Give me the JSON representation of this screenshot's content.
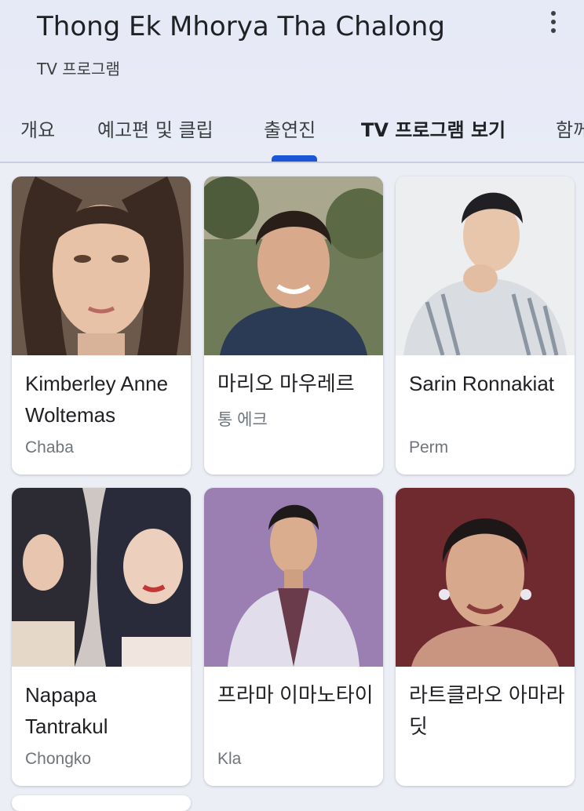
{
  "header": {
    "title": "Thong Ek Mhorya Tha Chalong",
    "subtitle": "TV 프로그램",
    "menu_icon": "more-vert-icon"
  },
  "tabs": [
    {
      "label": "개요",
      "selected": false
    },
    {
      "label": "예고편 및 클립",
      "selected": false
    },
    {
      "label": "출연진",
      "selected": true
    },
    {
      "label": "TV 프로그램 보기",
      "selected": false
    },
    {
      "label": "함께",
      "selected": false
    }
  ],
  "colors": {
    "header_bg": "#e6e9f6",
    "page_bg": "#eceef6",
    "tab_indicator": "#1a56d6",
    "secondary_text": "#70757a"
  },
  "cast": [
    {
      "name": "Kimberley Anne Woltemas",
      "role": "Chaba"
    },
    {
      "name": "마리오 마우레르",
      "role": "통 에크"
    },
    {
      "name": "Sarin Ronnakiat",
      "role": "Perm"
    },
    {
      "name": "Napapa Tantrakul",
      "role": "Chongko"
    },
    {
      "name": "프라마 이마노타이",
      "role": "Kla"
    },
    {
      "name": "라트클라오 아마라딧",
      "role": ""
    }
  ]
}
